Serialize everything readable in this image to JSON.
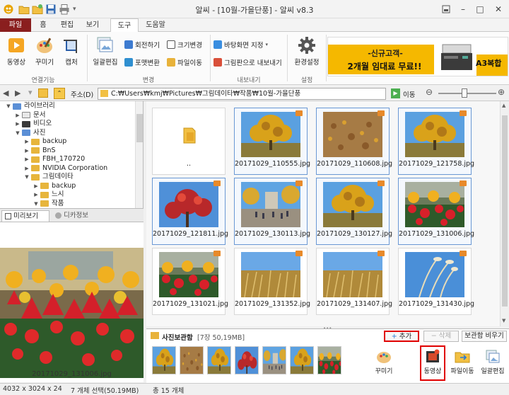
{
  "window": {
    "title": "알씨 - [10월-가을단풍] - 알씨 v8.3"
  },
  "menu_tabs": [
    "파일",
    "홈",
    "편집",
    "보기",
    "도구",
    "도움말"
  ],
  "ribbon": {
    "linked": {
      "label": "연결기능",
      "items": [
        "동영상",
        "꾸미기",
        "캡처"
      ]
    },
    "convert": {
      "label": "변경",
      "batch_edit": "일괄편집",
      "items": [
        "회전하기",
        "크기변경",
        "포맷변환",
        "파일이동"
      ]
    },
    "export": {
      "label": "내보내기",
      "items": [
        "바탕화면 지정",
        "그림판으로 내보내기"
      ]
    },
    "settings": {
      "label": "설정",
      "env": "환경설정"
    }
  },
  "ad": {
    "line1": "-신규고객-",
    "line2": "2개월 임대료 무료!!",
    "side": "A3복합"
  },
  "address": {
    "label": "주소(D)",
    "path": "C:₩Users₩kmj₩Pictures₩그림데이타₩작품₩10월-가을단풍",
    "go": "이동"
  },
  "tree": [
    {
      "label": "라이브러리",
      "depth": 1,
      "toggle": "▼",
      "kind": "lib"
    },
    {
      "label": "문서",
      "depth": 2,
      "toggle": "▶",
      "kind": "doc"
    },
    {
      "label": "비디오",
      "depth": 2,
      "toggle": "▶",
      "kind": "video"
    },
    {
      "label": "사진",
      "depth": 2,
      "toggle": "▼",
      "kind": "photo"
    },
    {
      "label": "backup",
      "depth": 3,
      "toggle": "▶",
      "kind": "folder"
    },
    {
      "label": "BnS",
      "depth": 3,
      "toggle": "▶",
      "kind": "folder"
    },
    {
      "label": "FBH_170720",
      "depth": 3,
      "toggle": "▶",
      "kind": "folder"
    },
    {
      "label": "NVIDIA Corporation",
      "depth": 3,
      "toggle": "▶",
      "kind": "folder"
    },
    {
      "label": "그림데이타",
      "depth": 3,
      "toggle": "▼",
      "kind": "folder"
    },
    {
      "label": "backup",
      "depth": 4,
      "toggle": "▶",
      "kind": "folder"
    },
    {
      "label": "느시",
      "depth": 4,
      "toggle": "▶",
      "kind": "folder"
    },
    {
      "label": "작품",
      "depth": 4,
      "toggle": "▼",
      "kind": "folder"
    }
  ],
  "preview_tabs": [
    "미리보기",
    "디카정보"
  ],
  "preview_filename": "20171029_131006.jpg",
  "files": [
    {
      "name": "..",
      "type": "folder",
      "selected": false
    },
    {
      "name": "20171029_110555.jpg",
      "type": "tree",
      "selected": true
    },
    {
      "name": "20171029_110608.jpg",
      "type": "ground",
      "selected": true
    },
    {
      "name": "20171029_121758.jpg",
      "type": "tree",
      "selected": true
    },
    {
      "name": "20171029_121811.jpg",
      "type": "redtree",
      "selected": true
    },
    {
      "name": "20171029_130113.jpg",
      "type": "crowd",
      "selected": true
    },
    {
      "name": "20171029_130127.jpg",
      "type": "tree",
      "selected": true
    },
    {
      "name": "20171029_131006.jpg",
      "type": "flowers",
      "selected": true
    },
    {
      "name": "20171029_131021.jpg",
      "type": "flowers",
      "selected": false
    },
    {
      "name": "20171029_131352.jpg",
      "type": "grass",
      "selected": false
    },
    {
      "name": "20171029_131407.jpg",
      "type": "grass",
      "selected": false
    },
    {
      "name": "20171029_131430.jpg",
      "type": "reed",
      "selected": false
    }
  ],
  "storage": {
    "title": "사진보관함",
    "count": "[7장 50,19MB]",
    "add": "추가",
    "delete": "삭제",
    "clear": "보관함 비우기",
    "thumbs": [
      "tree",
      "ground",
      "tree",
      "redtree",
      "crowd",
      "tree",
      "flowers"
    ],
    "actions": [
      "꾸미기",
      "동영상",
      "파일이동",
      "일괄편집"
    ]
  },
  "status": {
    "resolution": "4032 x 3024 x 24",
    "selection": "7 개체 선택(50.19MB)",
    "total": "총 15 개체"
  },
  "colors": {
    "file_tab": "#8a1e1e",
    "selection_border": "#6a98d4",
    "highlight": "#e00000",
    "ad_bg": "#f5b800"
  }
}
